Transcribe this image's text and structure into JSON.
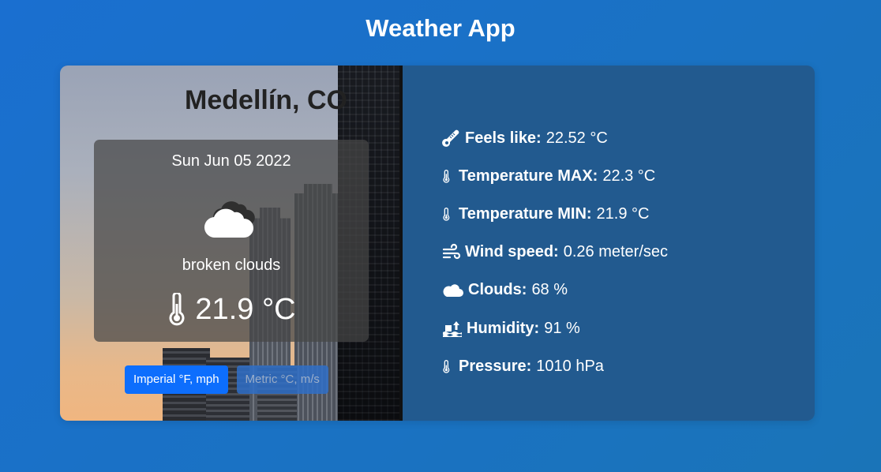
{
  "app": {
    "title": "Weather App"
  },
  "location": {
    "city": "Medellín, CO"
  },
  "summary": {
    "date": "Sun Jun 05 2022",
    "description": "broken clouds",
    "temperature": "21.9 °C",
    "weather_icon": "cloud-icon",
    "temp_icon": "thermometer-icon"
  },
  "units": {
    "imperial_label": "Imperial °F, mph",
    "metric_label": "Metric °C, m/s",
    "selected": "imperial"
  },
  "details": [
    {
      "icon": "temperature-feel-icon",
      "label": "Feels like:",
      "value": "22.52 °C"
    },
    {
      "icon": "thermometer-icon",
      "label": "Temperature MAX:",
      "value": "22.3 °C"
    },
    {
      "icon": "thermometer-icon",
      "label": "Temperature MIN:",
      "value": "21.9 °C"
    },
    {
      "icon": "wind-icon",
      "label": "Wind speed:",
      "value": "0.26 meter/sec"
    },
    {
      "icon": "cloud-icon",
      "label": "Clouds:",
      "value": "68 %"
    },
    {
      "icon": "humidity-icon",
      "label": "Humidity:",
      "value": "91 %"
    },
    {
      "icon": "thermometer-icon",
      "label": "Pressure:",
      "value": "1010 hPa"
    }
  ],
  "colors": {
    "primary_button": "#0d6efd",
    "right_panel": "#225a8f",
    "background": "#1a6fd0"
  }
}
